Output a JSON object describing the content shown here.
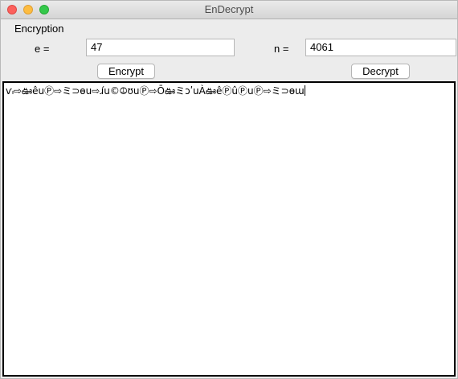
{
  "window": {
    "title": "EnDecrypt"
  },
  "form": {
    "section_label": "Encryption",
    "e_label": "e =",
    "e_value": "47",
    "n_label": "n =",
    "n_value": "4061",
    "encrypt_label": "Encrypt",
    "decrypt_label": "Decrypt"
  },
  "output": {
    "text": "ѵ៲⇨ఊêսⓅ⇨ミ⊃ѳս⇨ɹ́ս©⦹ʊսⓅ⇨ŌఊミɔʹսÀఊêⓅûⓅսⓅ⇨ミ⊃ѳա"
  },
  "colors": {
    "close": "#fc605c",
    "minimize": "#fdbc40",
    "maximize": "#34c84a",
    "window_bg": "#ececec"
  }
}
